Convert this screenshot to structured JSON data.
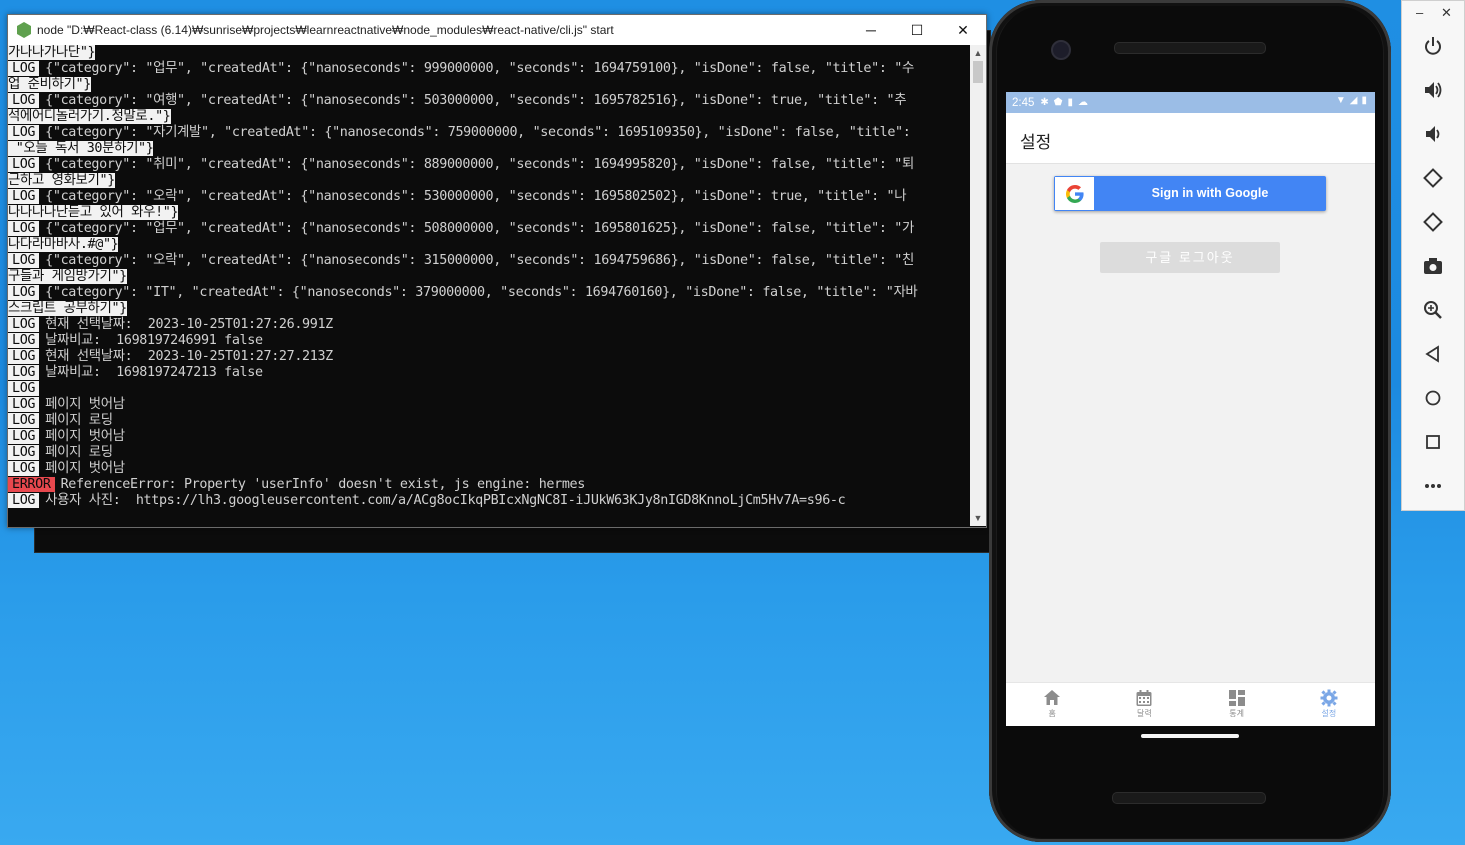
{
  "console": {
    "title": "node  \"D:₩React-class (6.14)₩sunrise₩projects₩learnreactnative₩node_modules₩react-native/cli.js\" start",
    "buttons": {
      "minimize": "─",
      "maximize": "☐",
      "close": "✕"
    },
    "lines": [
      {
        "tag": "",
        "text": "",
        "wrap": "가나나가나단\"}"
      },
      {
        "tag": "LOG",
        "text": "{\"category\": \"업무\", \"createdAt\": {\"nanoseconds\": 999000000, \"seconds\": 1694759100}, \"isDone\": false, \"title\": \"수",
        "wrap": ""
      },
      {
        "tag": "",
        "text": "",
        "wrap": "업 준비하기\"}"
      },
      {
        "tag": "LOG",
        "text": "{\"category\": \"여행\", \"createdAt\": {\"nanoseconds\": 503000000, \"seconds\": 1695782516}, \"isDone\": true, \"title\": \"추",
        "wrap": ""
      },
      {
        "tag": "",
        "text": "",
        "wrap": "석에어디놀러가기.정말로.\"}"
      },
      {
        "tag": "LOG",
        "text": "{\"category\": \"자기계발\", \"createdAt\": {\"nanoseconds\": 759000000, \"seconds\": 1695109350}, \"isDone\": false, \"title\":",
        "wrap": ""
      },
      {
        "tag": "",
        "text": "",
        "wrap": " \"오늘 독서 30분하기\"}"
      },
      {
        "tag": "LOG",
        "text": "{\"category\": \"취미\", \"createdAt\": {\"nanoseconds\": 889000000, \"seconds\": 1694995820}, \"isDone\": false, \"title\": \"퇴",
        "wrap": ""
      },
      {
        "tag": "",
        "text": "",
        "wrap": "근하고 영화보기\"}"
      },
      {
        "tag": "LOG",
        "text": "{\"category\": \"오락\", \"createdAt\": {\"nanoseconds\": 530000000, \"seconds\": 1695802502}, \"isDone\": true, \"title\": \"나",
        "wrap": ""
      },
      {
        "tag": "",
        "text": "",
        "wrap": "나나나나난듣고 있어 와우!\"}"
      },
      {
        "tag": "LOG",
        "text": "{\"category\": \"업무\", \"createdAt\": {\"nanoseconds\": 508000000, \"seconds\": 1695801625}, \"isDone\": false, \"title\": \"가",
        "wrap": ""
      },
      {
        "tag": "",
        "text": "",
        "wrap": "나다라마바사.#@\"}"
      },
      {
        "tag": "LOG",
        "text": "{\"category\": \"오락\", \"createdAt\": {\"nanoseconds\": 315000000, \"seconds\": 1694759686}, \"isDone\": false, \"title\": \"친",
        "wrap": ""
      },
      {
        "tag": "",
        "text": "",
        "wrap": "구들과 게임방가기\"}"
      },
      {
        "tag": "LOG",
        "text": "{\"category\": \"IT\", \"createdAt\": {\"nanoseconds\": 379000000, \"seconds\": 1694760160}, \"isDone\": false, \"title\": \"자바",
        "wrap": ""
      },
      {
        "tag": "",
        "text": "",
        "wrap": "스크립트 공부하기\"}"
      },
      {
        "tag": "LOG",
        "text": "현재 선택날짜:  2023-10-25T01:27:26.991Z",
        "wrap": ""
      },
      {
        "tag": "LOG",
        "text": "날짜비교:  1698197246991 false",
        "wrap": ""
      },
      {
        "tag": "LOG",
        "text": "현재 선택날짜:  2023-10-25T01:27:27.213Z",
        "wrap": ""
      },
      {
        "tag": "LOG",
        "text": "날짜비교:  1698197247213 false",
        "wrap": ""
      },
      {
        "tag": "LOG",
        "text": "",
        "wrap": ""
      },
      {
        "tag": "LOG",
        "text": "페이지 벗어남",
        "wrap": ""
      },
      {
        "tag": "LOG",
        "text": "페이지 로딩",
        "wrap": ""
      },
      {
        "tag": "LOG",
        "text": "페이지 벗어남",
        "wrap": ""
      },
      {
        "tag": "LOG",
        "text": "페이지 로딩",
        "wrap": ""
      },
      {
        "tag": "LOG",
        "text": "페이지 벗어남",
        "wrap": ""
      },
      {
        "tag": "ERROR",
        "text": "ReferenceError: Property 'userInfo' doesn't exist, js engine: hermes",
        "wrap": ""
      },
      {
        "tag": "LOG",
        "text": "사용자 사진:  https://lh3.googleusercontent.com/a/ACg8ocIkqPBIcxNgNC8I-iJUkW63KJy8nIGD8KnnoLjCm5Hv7A=s96-c",
        "wrap": ""
      }
    ]
  },
  "phone": {
    "status_time": "2:45",
    "header_title": "설정",
    "google_button_label": "Sign in with Google",
    "logout_button_label": "구글 로그아웃",
    "tabs": [
      {
        "label": "홈",
        "icon": "home-icon",
        "active": false
      },
      {
        "label": "달력",
        "icon": "calendar-icon",
        "active": false
      },
      {
        "label": "통계",
        "icon": "dashboard-icon",
        "active": false
      },
      {
        "label": "설정",
        "icon": "gear-icon",
        "active": true
      }
    ]
  },
  "emulator": {
    "minimize": "–",
    "close": "✕",
    "tools": [
      "power-icon",
      "volume-up-icon",
      "volume-down-icon",
      "rotate-left-icon",
      "rotate-right-icon",
      "camera-icon",
      "zoom-icon",
      "back-icon",
      "home-circle-icon",
      "overview-icon",
      "more-icon"
    ]
  },
  "colors": {
    "accent": "#4285f4",
    "active_tab": "#7ba7e6",
    "error_tag": "#e8484e"
  }
}
